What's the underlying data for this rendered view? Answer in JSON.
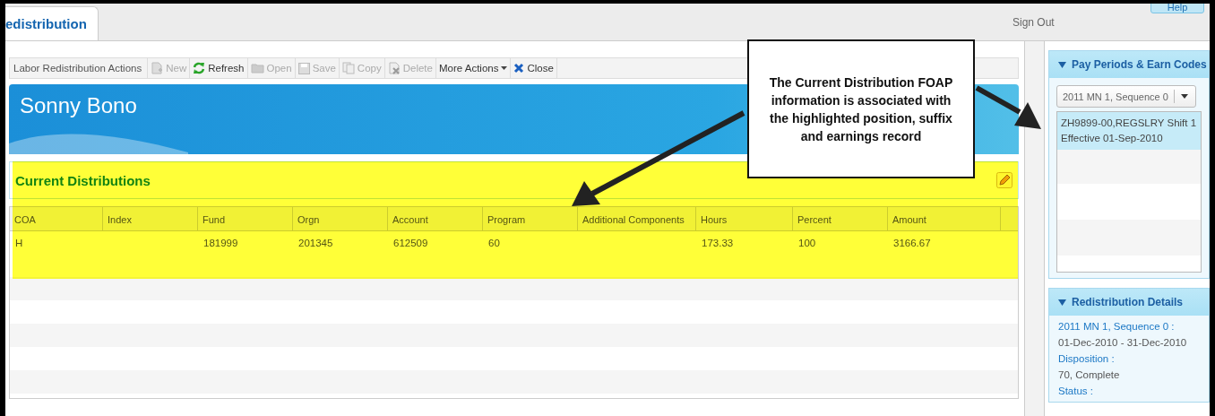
{
  "tab": {
    "label": "edistribution",
    "selected": true
  },
  "help_button": "Help",
  "sign_out": "Sign Out",
  "toolbar": {
    "title": "Labor Redistribution Actions",
    "items": [
      {
        "label": "New",
        "kind": "button",
        "disabled": true
      },
      {
        "label": "Refresh",
        "kind": "button",
        "disabled": false
      },
      {
        "label": "Open",
        "kind": "button",
        "disabled": true
      },
      {
        "label": "Save",
        "kind": "button",
        "disabled": true
      },
      {
        "label": "Copy",
        "kind": "button",
        "disabled": true
      },
      {
        "label": "Delete",
        "kind": "button",
        "disabled": true
      },
      {
        "label": "More Actions",
        "kind": "menu",
        "disabled": false
      },
      {
        "label": "Close",
        "kind": "button",
        "disabled": false
      }
    ]
  },
  "employee_name": "Sonny Bono",
  "section_title": "Current Distributions",
  "table": {
    "columns": [
      "COA",
      "Index",
      "Fund",
      "Orgn",
      "Account",
      "Program",
      "Additional Components",
      "Hours",
      "Percent",
      "Amount"
    ],
    "rows": [
      [
        "H",
        "",
        "181999",
        "201345",
        "612509",
        "60",
        "",
        "173.33",
        "100",
        "3166.67"
      ]
    ]
  },
  "callout": "The Current Distribution FOAP information is associated with the highlighted position, suffix and earnings record",
  "pay_periods": {
    "title": "Pay Periods & Earn Codes",
    "expanded": true,
    "select_value": "2011 MN 1, Sequence 0",
    "items": [
      {
        "lines": [
          "ZH9899-00,REGSLRY Shift 1",
          "Effective 01-Sep-2010"
        ],
        "selected": true
      }
    ]
  },
  "details": {
    "title": "Redistribution Details",
    "expanded": true,
    "fields": [
      {
        "label": "2011 MN 1, Sequence 0 :",
        "value": "01-Dec-2010 - 31-Dec-2010"
      },
      {
        "label": "Disposition :",
        "value": "70, Complete"
      },
      {
        "label": "Status :"
      }
    ]
  }
}
